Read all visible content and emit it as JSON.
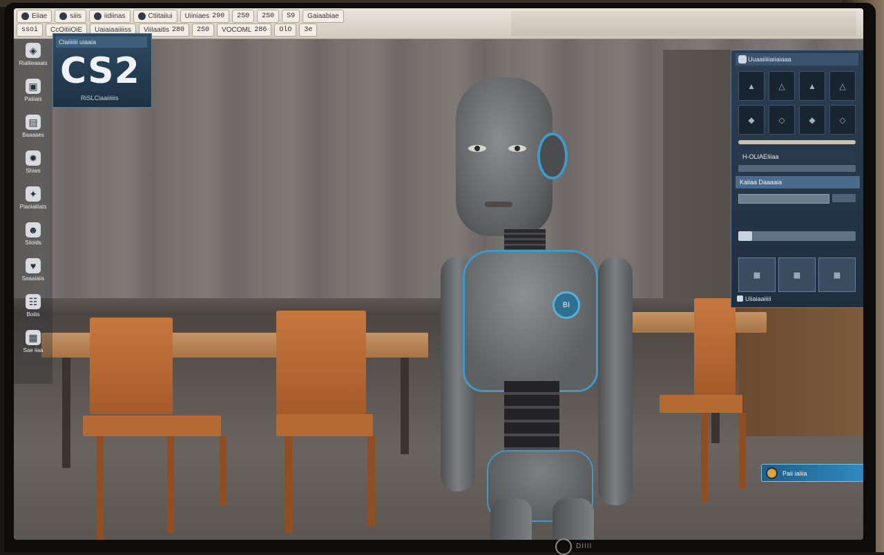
{
  "toolbar": {
    "row1": [
      {
        "label": "Eiiae",
        "icon": "app-icon",
        "value": ""
      },
      {
        "label": "siiis",
        "icon": "grid-icon",
        "value": ""
      },
      {
        "label": "iidiinas",
        "icon": "link-icon",
        "value": ""
      },
      {
        "label": "Ctiitaiiui",
        "icon": "eye-icon",
        "value": ""
      },
      {
        "label": "Uiiniaes",
        "icon": "",
        "value": "290"
      },
      {
        "label": "",
        "icon": "",
        "value": "2S0"
      },
      {
        "label": "",
        "icon": "",
        "value": "2S0"
      },
      {
        "label": "",
        "icon": "",
        "value": "S9"
      },
      {
        "label": "Gaiaabiae",
        "icon": "",
        "value": ""
      }
    ],
    "row2": [
      {
        "label": "",
        "icon": "",
        "value": "ssoi"
      },
      {
        "label": "CcOitiiOiE",
        "icon": "",
        "value": ""
      },
      {
        "label": "Uaiaiaaiiiiss",
        "icon": "",
        "value": ""
      },
      {
        "label": "ViiIaaitis",
        "icon": "",
        "value": "280"
      },
      {
        "label": "",
        "icon": "",
        "value": "2S0"
      },
      {
        "label": "VOCOML",
        "icon": "",
        "value": "286"
      },
      {
        "label": "",
        "icon": "",
        "value": "OlO"
      },
      {
        "label": "",
        "icon": "",
        "value": "3e"
      }
    ]
  },
  "sidebar": {
    "items": [
      {
        "label": "Rialiieaaais",
        "icon": "cube-icon",
        "glyph": "◈"
      },
      {
        "label": "Paiiiais",
        "icon": "layers-icon",
        "glyph": "▣"
      },
      {
        "label": "Baaaaes",
        "icon": "folder-icon",
        "glyph": "▤"
      },
      {
        "label": "Shiws",
        "icon": "gear-icon",
        "glyph": "✹"
      },
      {
        "label": "Piaoiaitiats",
        "icon": "paint-icon",
        "glyph": "✦"
      },
      {
        "label": "Siioids",
        "icon": "person-icon",
        "glyph": "☻"
      },
      {
        "label": "Seaaiaiis",
        "icon": "heart-icon",
        "glyph": "♥"
      },
      {
        "label": "Boiiis",
        "icon": "group-icon",
        "glyph": "☷"
      },
      {
        "label": "Sae iiaa",
        "icon": "film-icon",
        "glyph": "▦"
      }
    ]
  },
  "logo": {
    "header": "Claiiiiiii uiaaia",
    "title": "CS2",
    "subtitle": "RiSLCiaaiiiiiis"
  },
  "robot": {
    "badge": "BI"
  },
  "right_panel": {
    "header": "Uuaaiiiiiaiiaiaaa",
    "grid_cells": [
      "▲",
      "△",
      "▲",
      "△",
      "◆",
      "◇",
      "◆",
      "◇"
    ],
    "title": "H-OLIAEIiiaa",
    "tab": "Kaiiaa Daaaaia",
    "thumbs": [
      "▦",
      "▦",
      "▦"
    ],
    "footer": "Uiiaiaaiiiii"
  },
  "notification": {
    "text": "Paii iaiiia"
  },
  "monitor": {
    "brand": "DIIII"
  },
  "colors": {
    "accent": "#3e9ac8",
    "panel": "#2c3e52",
    "wood": "#c5783e"
  }
}
